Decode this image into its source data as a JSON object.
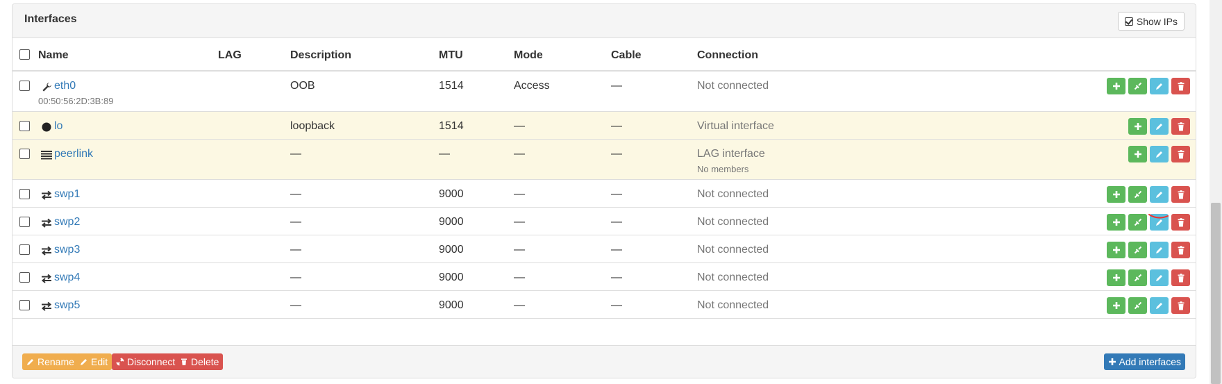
{
  "panel": {
    "title": "Interfaces",
    "show_ips_label": "Show IPs"
  },
  "columns": {
    "name": "Name",
    "lag": "LAG",
    "description": "Description",
    "mtu": "MTU",
    "mode": "Mode",
    "cable": "Cable",
    "connection": "Connection"
  },
  "rows": [
    {
      "icon": "wrench-icon",
      "name": "eth0",
      "sub": "00:50:56:2D:3B:89",
      "lag": "",
      "description": "OOB",
      "mtu": "1514",
      "mode": "Access",
      "cable": "—",
      "connection": "Not connected",
      "connection_sub": "",
      "virtual": false,
      "actions": [
        "add",
        "connect",
        "edit",
        "delete"
      ]
    },
    {
      "icon": "circle-icon",
      "name": "lo",
      "sub": "",
      "lag": "",
      "description": "loopback",
      "mtu": "1514",
      "mode": "—",
      "cable": "—",
      "connection": "Virtual interface",
      "connection_sub": "",
      "virtual": true,
      "actions": [
        "add",
        "edit",
        "delete"
      ]
    },
    {
      "icon": "list-icon",
      "name": "peerlink",
      "sub": "",
      "lag": "",
      "description": "—",
      "mtu": "—",
      "mode": "—",
      "cable": "—",
      "connection": "LAG interface",
      "connection_sub": "No members",
      "virtual": true,
      "actions": [
        "add",
        "edit",
        "delete"
      ]
    },
    {
      "icon": "exchange-icon",
      "name": "swp1",
      "sub": "",
      "lag": "",
      "description": "—",
      "mtu": "9000",
      "mode": "—",
      "cable": "—",
      "connection": "Not connected",
      "connection_sub": "",
      "virtual": false,
      "actions": [
        "add",
        "connect",
        "edit",
        "delete"
      ]
    },
    {
      "icon": "exchange-icon",
      "name": "swp2",
      "sub": "",
      "lag": "",
      "description": "—",
      "mtu": "9000",
      "mode": "—",
      "cable": "—",
      "connection": "Not connected",
      "connection_sub": "",
      "virtual": false,
      "actions": [
        "add",
        "connect",
        "edit",
        "delete"
      ]
    },
    {
      "icon": "exchange-icon",
      "name": "swp3",
      "sub": "",
      "lag": "",
      "description": "—",
      "mtu": "9000",
      "mode": "—",
      "cable": "—",
      "connection": "Not connected",
      "connection_sub": "",
      "virtual": false,
      "actions": [
        "add",
        "connect",
        "edit",
        "delete"
      ]
    },
    {
      "icon": "exchange-icon",
      "name": "swp4",
      "sub": "",
      "lag": "",
      "description": "—",
      "mtu": "9000",
      "mode": "—",
      "cable": "—",
      "connection": "Not connected",
      "connection_sub": "",
      "virtual": false,
      "actions": [
        "add",
        "connect",
        "edit",
        "delete"
      ]
    },
    {
      "icon": "exchange-icon",
      "name": "swp5",
      "sub": "",
      "lag": "",
      "description": "—",
      "mtu": "9000",
      "mode": "—",
      "cable": "—",
      "connection": "Not connected",
      "connection_sub": "",
      "virtual": false,
      "actions": [
        "add",
        "connect",
        "edit",
        "delete"
      ]
    }
  ],
  "footer": {
    "rename_label": "Rename",
    "edit_label": "Edit",
    "disconnect_label": "Disconnect",
    "delete_label": "Delete",
    "add_label": "Add interfaces"
  },
  "colors": {
    "success": "#5cb85c",
    "info": "#5bc0de",
    "danger": "#d9534f",
    "warning": "#f0ad4e",
    "primary": "#337ab7",
    "virtual_row": "#fcf8e3"
  }
}
